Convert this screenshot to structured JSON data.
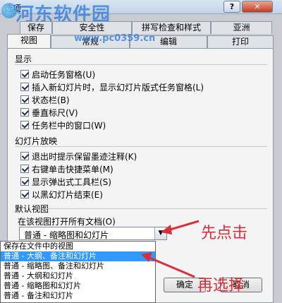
{
  "window": {
    "title": "选项",
    "help_label": "?",
    "close_label": "✕"
  },
  "watermark": {
    "text": "河东软件园",
    "url": "www.pc0359.cn"
  },
  "tabs_back": [
    "保存",
    "安全性",
    "拼写检查和样式",
    "亚洲"
  ],
  "tabs_front": [
    "视图",
    "常规",
    "编辑",
    "打印"
  ],
  "display": {
    "title": "显示",
    "items": [
      "启动任务窗格(U)",
      "插入新幻灯片时，显示幻灯片版式任务窗格(L)",
      "状态栏(B)",
      "垂直标尺(V)",
      "任务栏中的窗口(W)"
    ]
  },
  "slideshow": {
    "title": "幻灯片放映",
    "items": [
      "退出时提示保留墨迹注释(K)",
      "右键单击快捷菜单(M)",
      "显示弹出式工具栏(S)",
      "以黑幻灯片结束(E)"
    ]
  },
  "default_view": {
    "title": "默认视图",
    "label": "在该视图打开所有文档(O)",
    "selected": "普通 - 缩略图和幻灯片",
    "options": [
      "保存在文件中的视图",
      "普通 - 大纲、备注和幻灯片",
      "普通 - 缩略图、备注和幻灯片",
      "普通 - 大纲和幻灯片",
      "普通 - 缩略图和幻灯片",
      "普通 - 备注和幻灯片"
    ],
    "highlighted_index": 1
  },
  "buttons": {
    "ok": "确定",
    "cancel": "取消"
  },
  "annotations": {
    "first": "先点击",
    "second": "再选择"
  },
  "colors": {
    "annotation": "#d8303a",
    "selection": "#3399ff",
    "watermark": "#2878dc"
  }
}
